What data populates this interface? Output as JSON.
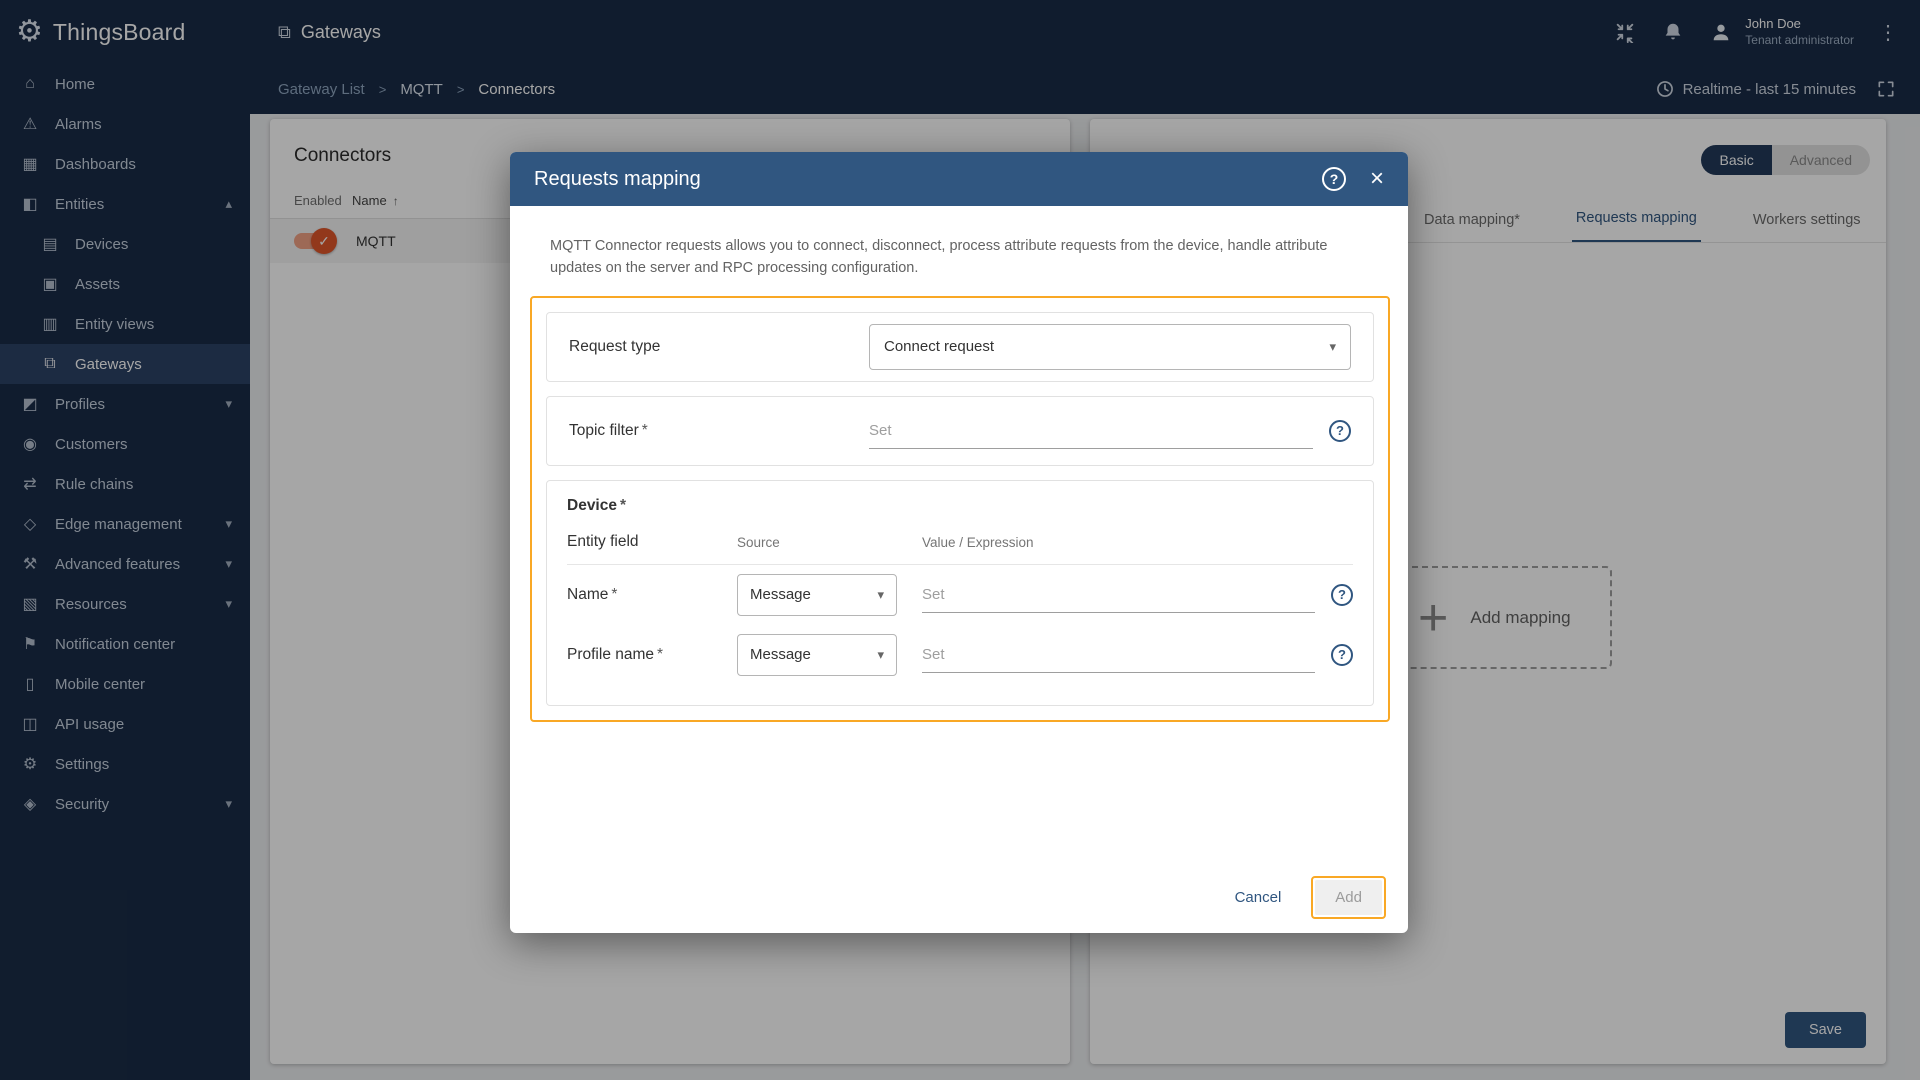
{
  "colors": {
    "primary": "#305680",
    "sidebar_bg": "#1a2c47",
    "highlight": "#f9a825",
    "toggle_on": "#e0572a"
  },
  "app": {
    "name": "ThingsBoard"
  },
  "topbar": {
    "page_title": "Gateways",
    "user": {
      "name": "John Doe",
      "role": "Tenant administrator"
    }
  },
  "breadcrumb": {
    "items": [
      {
        "label": "Gateway List"
      },
      {
        "label": "MQTT"
      },
      {
        "label": "Connectors"
      }
    ],
    "separator": ">",
    "realtime": "Realtime - last 15 minutes"
  },
  "sidebar": {
    "items": [
      {
        "label": "Home",
        "icon": "⌂"
      },
      {
        "label": "Alarms",
        "icon": "⚠"
      },
      {
        "label": "Dashboards",
        "icon": "▦"
      },
      {
        "label": "Entities",
        "icon": "◧"
      },
      {
        "label": "Devices",
        "icon": "▤"
      },
      {
        "label": "Assets",
        "icon": "▣"
      },
      {
        "label": "Entity views",
        "icon": "▥"
      },
      {
        "label": "Gateways",
        "icon": "⧉"
      },
      {
        "label": "Profiles",
        "icon": "◩"
      },
      {
        "label": "Customers",
        "icon": "◉"
      },
      {
        "label": "Rule chains",
        "icon": "⇄"
      },
      {
        "label": "Edge management",
        "icon": "◇"
      },
      {
        "label": "Advanced features",
        "icon": "⚒"
      },
      {
        "label": "Resources",
        "icon": "▧"
      },
      {
        "label": "Notification center",
        "icon": "⚑"
      },
      {
        "label": "Mobile center",
        "icon": "▯"
      },
      {
        "label": "API usage",
        "icon": "◫"
      },
      {
        "label": "Settings",
        "icon": "⚙"
      },
      {
        "label": "Security",
        "icon": "◈"
      }
    ]
  },
  "icons": {
    "expand_less": "▴",
    "expand_more": "▾",
    "sort_asc": "↑",
    "dots": "⋮",
    "close": "×",
    "help": "?",
    "plus": "+",
    "check": "✓",
    "select_arrow": "▾",
    "gateways": "⧉"
  },
  "connectors": {
    "title": "Connectors",
    "col_enabled": "Enabled",
    "col_name": "Name",
    "rows": [
      {
        "name": "MQTT"
      }
    ]
  },
  "config_panel": {
    "mode": {
      "basic": "Basic",
      "advanced": "Advanced"
    },
    "tabs": [
      {
        "label": "Data mapping*"
      },
      {
        "label": "Requests mapping"
      },
      {
        "label": "Workers settings"
      }
    ],
    "add_mapping_label": "Add mapping",
    "save_label": "Save"
  },
  "modal": {
    "title": "Requests mapping",
    "info_text": "MQTT Connector requests allows you to connect, disconnect, process attribute requests from the device, handle attribute updates on the server and RPC processing configuration.",
    "required_mark": "*",
    "request_type": {
      "label": "Request type",
      "value": "Connect request"
    },
    "topic_filter": {
      "label": "Topic filter",
      "placeholder": "Set"
    },
    "device": {
      "label": "Device",
      "columns": [
        {
          "label": "Entity field"
        },
        {
          "label": "Source"
        },
        {
          "label": "Value / Expression"
        }
      ],
      "rows": [
        {
          "field": "Name",
          "source": "Message",
          "placeholder": "Set"
        },
        {
          "field": "Profile name",
          "source": "Message",
          "placeholder": "Set"
        }
      ]
    },
    "cancel_label": "Cancel",
    "add_label": "Add"
  }
}
